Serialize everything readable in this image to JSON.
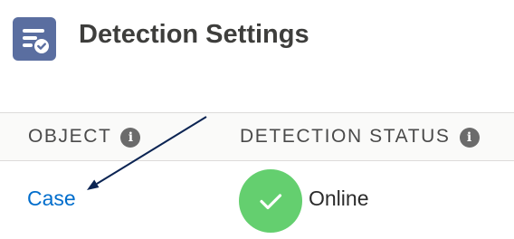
{
  "header": {
    "title": "Detection Settings",
    "icon": "settings-list-check-icon"
  },
  "table": {
    "columns": [
      {
        "label": "OBJECT",
        "info_icon": "info-icon"
      },
      {
        "label": "DETECTION STATUS",
        "info_icon": "info-icon"
      }
    ],
    "rows": [
      {
        "object": "Case",
        "status": "Online",
        "status_icon": "check-icon"
      }
    ]
  },
  "colors": {
    "icon_background": "#5a6ea0",
    "link": "#006dcc",
    "status_online": "#64cf6f",
    "annotation_arrow": "#0b2453"
  }
}
